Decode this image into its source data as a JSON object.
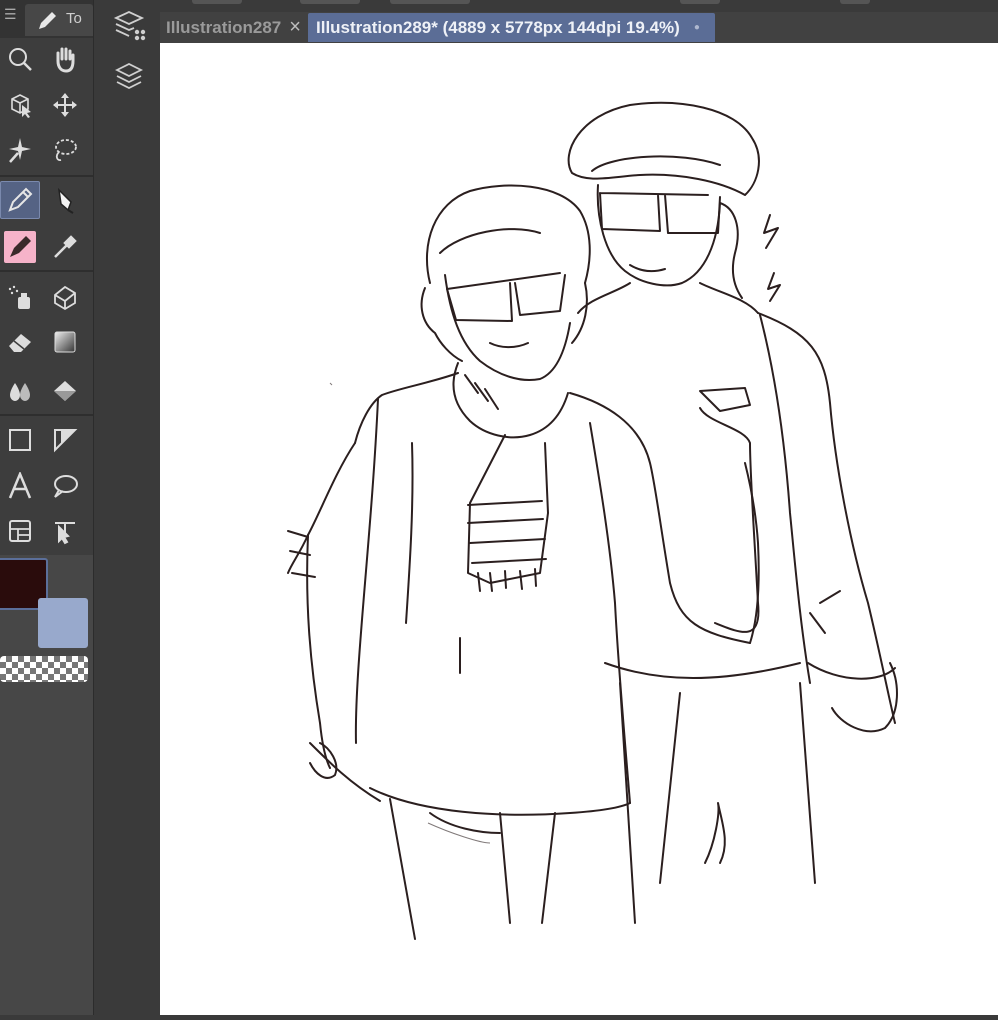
{
  "toolbar": {
    "tab_label": "To",
    "tools": [
      {
        "name": "zoom-tool",
        "icon": "magnifier-icon"
      },
      {
        "name": "hand-tool",
        "icon": "hand-icon"
      },
      {
        "name": "object-tool",
        "icon": "object-select-icon"
      },
      {
        "name": "move-layer-tool",
        "icon": "move-arrows-icon"
      },
      {
        "name": "auto-select-tool",
        "icon": "magic-wand-icon"
      },
      {
        "name": "lasso-select-tool",
        "icon": "lasso-icon"
      },
      {
        "name": "pen-tool",
        "icon": "pen-icon",
        "active": true
      },
      {
        "name": "pencil-tool",
        "icon": "fountain-pen-icon"
      },
      {
        "name": "brush-tool",
        "icon": "brush-icon"
      },
      {
        "name": "eyedropper-tool",
        "icon": "eyedropper-icon"
      },
      {
        "name": "airbrush-tool",
        "icon": "airbrush-icon"
      },
      {
        "name": "decoration-tool",
        "icon": "decoration-icon"
      },
      {
        "name": "eraser-tool",
        "icon": "eraser-icon"
      },
      {
        "name": "gradient-tool",
        "icon": "gradient-icon"
      },
      {
        "name": "blend-tool",
        "icon": "blend-drops-icon"
      },
      {
        "name": "fill-tool",
        "icon": "bucket-icon"
      },
      {
        "name": "figure-tool",
        "icon": "rectangle-icon"
      },
      {
        "name": "ruler-tool",
        "icon": "ruler-icon"
      },
      {
        "name": "text-tool",
        "icon": "text-A-icon"
      },
      {
        "name": "balloon-tool",
        "icon": "speech-balloon-icon"
      },
      {
        "name": "frame-border-tool",
        "icon": "frame-border-icon"
      },
      {
        "name": "correct-line-tool",
        "icon": "correct-line-icon"
      }
    ],
    "colors": {
      "main": "#2a0c0c",
      "sub": "#98a9cc",
      "transparent": "checker"
    }
  },
  "sidebar2": {
    "icons": [
      "layer-property-icon",
      "layers-icon"
    ]
  },
  "tabs": [
    {
      "label": "Illustration287",
      "close": "×",
      "active": false
    },
    {
      "label": "Illustration289* (4889 x 5778px 144dpi 19.4%)",
      "dot": "●",
      "active": true
    }
  ],
  "canvas": {
    "background": "#ffffff",
    "line_color": "#2b1f1f"
  }
}
